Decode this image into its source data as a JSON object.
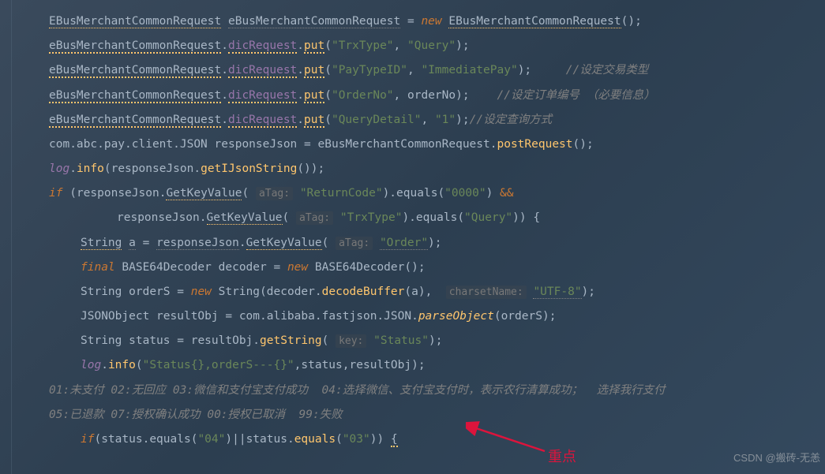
{
  "lines": {
    "l1_type": "EBusMerchantCommonRequest",
    "l1_var": "eBusMerchantCommonRequest",
    "l1_new": "new",
    "l1_ctor": "EBusMerchantCommonRequest",
    "l2_obj": "eBusMerchantCommonRequest",
    "l2_field": "dicRequest",
    "l2_method": "put",
    "l2_arg1": "\"TrxType\"",
    "l2_arg2": "\"Query\"",
    "l3_obj": "eBusMerchantCommonRequest",
    "l3_field": "dicRequest",
    "l3_method": "put",
    "l3_arg1": "\"PayTypeID\"",
    "l3_arg2": "\"ImmediatePay\"",
    "l3_comment": "//设定交易类型",
    "l4_obj": "eBusMerchantCommonRequest",
    "l4_field": "dicRequest",
    "l4_method": "put",
    "l4_arg1": "\"OrderNo\"",
    "l4_arg2": "orderNo",
    "l4_comment": "//设定订单编号 （必要信息）",
    "l5_obj": "eBusMerchantCommonRequest",
    "l5_field": "dicRequest",
    "l5_method": "put",
    "l5_arg1": "\"QueryDetail\"",
    "l5_arg2": "\"1\"",
    "l5_comment": "//设定查询方式",
    "l6_pkg": "com.abc.pay.client.JSON",
    "l6_var": "responseJson",
    "l6_obj": "eBusMerchantCommonRequest",
    "l6_method": "postRequest",
    "l7_log": "log",
    "l7_info": "info",
    "l7_obj": "responseJson",
    "l7_method": "getIJsonString",
    "l8_if": "if",
    "l8_obj": "responseJson",
    "l8_method": "GetKeyValue",
    "l8_hint": "aTag:",
    "l8_str": "\"ReturnCode\"",
    "l8_eq": "equals",
    "l8_val": "\"0000\"",
    "l8_and": "&&",
    "l9_obj": "responseJson",
    "l9_method": "GetKeyValue",
    "l9_hint": "aTag:",
    "l9_str": "\"TrxType\"",
    "l9_eq": "equals",
    "l9_val": "\"Query\"",
    "l10_type": "String",
    "l10_var": "a",
    "l10_obj": "responseJson",
    "l10_method": "GetKeyValue",
    "l10_hint": "aTag:",
    "l10_str": "\"Order\"",
    "l11_final": "final",
    "l11_type": "BASE64Decoder",
    "l11_var": "decoder",
    "l11_new": "new",
    "l12_type": "String",
    "l12_var": "orderS",
    "l12_new": "new",
    "l12_ctor": "String",
    "l12_dec": "decoder",
    "l12_method": "decodeBuffer",
    "l12_arg": "a",
    "l12_hint": "charsetName:",
    "l12_charset": "\"UTF-8\"",
    "l13_type": "JSONObject",
    "l13_var": "resultObj",
    "l13_pkg": "com.alibaba.fastjson.JSON",
    "l13_method": "parseObject",
    "l13_arg": "orderS",
    "l14_type": "String",
    "l14_var": "status",
    "l14_obj": "resultObj",
    "l14_method": "getString",
    "l14_hint": "key:",
    "l14_str": "\"Status\"",
    "l15_log": "log",
    "l15_info": "info",
    "l15_str": "\"Status{},orderS---{}\"",
    "l15_a1": "status",
    "l15_a2": "resultObj",
    "l16_comment": "01:未支付 02:无回应 03:微信和支付宝支付成功  04:选择微信、支付宝支付时，表示农行清算成功；  选择我行支付",
    "l17_comment": "05:已退款 07:授权确认成功 00:授权已取消  99:失败",
    "l18_if": "if",
    "l18_var": "status",
    "l18_eq": "equals",
    "l18_v1": "\"04\"",
    "l18_v2": "\"03\""
  },
  "annotation": "重点",
  "watermark": "CSDN @搬砖-无恙"
}
